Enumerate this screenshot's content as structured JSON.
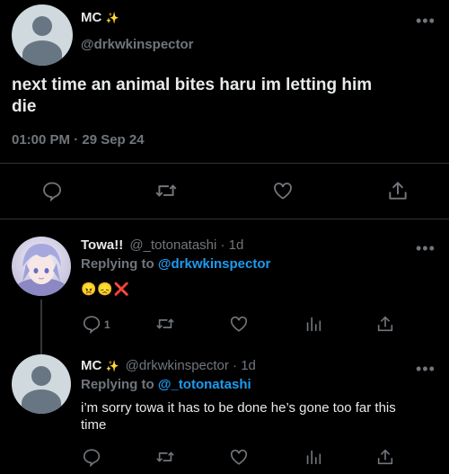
{
  "main_tweet": {
    "display_name": "MC",
    "name_emoji": "✨",
    "handle": "@drkwkinspector",
    "text_line1": "next time an animal bites haru im letting him",
    "text_line2": "die",
    "timestamp": "01:00 PM · 29 Sep 24"
  },
  "reply1": {
    "display_name": "Towa!!",
    "handle_meta": "@_totonatashi · 1d",
    "replying_prefix": "Replying to",
    "replying_to": "@drkwkinspector",
    "emoji_text": "😠😞❌",
    "reply_count": "1"
  },
  "reply2": {
    "display_name": "MC",
    "name_emoji": "✨",
    "handle_meta": "@drkwkinspector · 1d",
    "replying_prefix": "Replying to",
    "replying_to": "@_totonatashi",
    "text_line1": "i’m sorry towa it has to be done he’s gone too far this",
    "text_line2": "time"
  },
  "icons": {
    "more": "•••"
  },
  "colors": {
    "background": "#000000",
    "text": "#e7e9ea",
    "muted": "#71767b",
    "link": "#1d9bf0",
    "divider": "#2f3336"
  }
}
